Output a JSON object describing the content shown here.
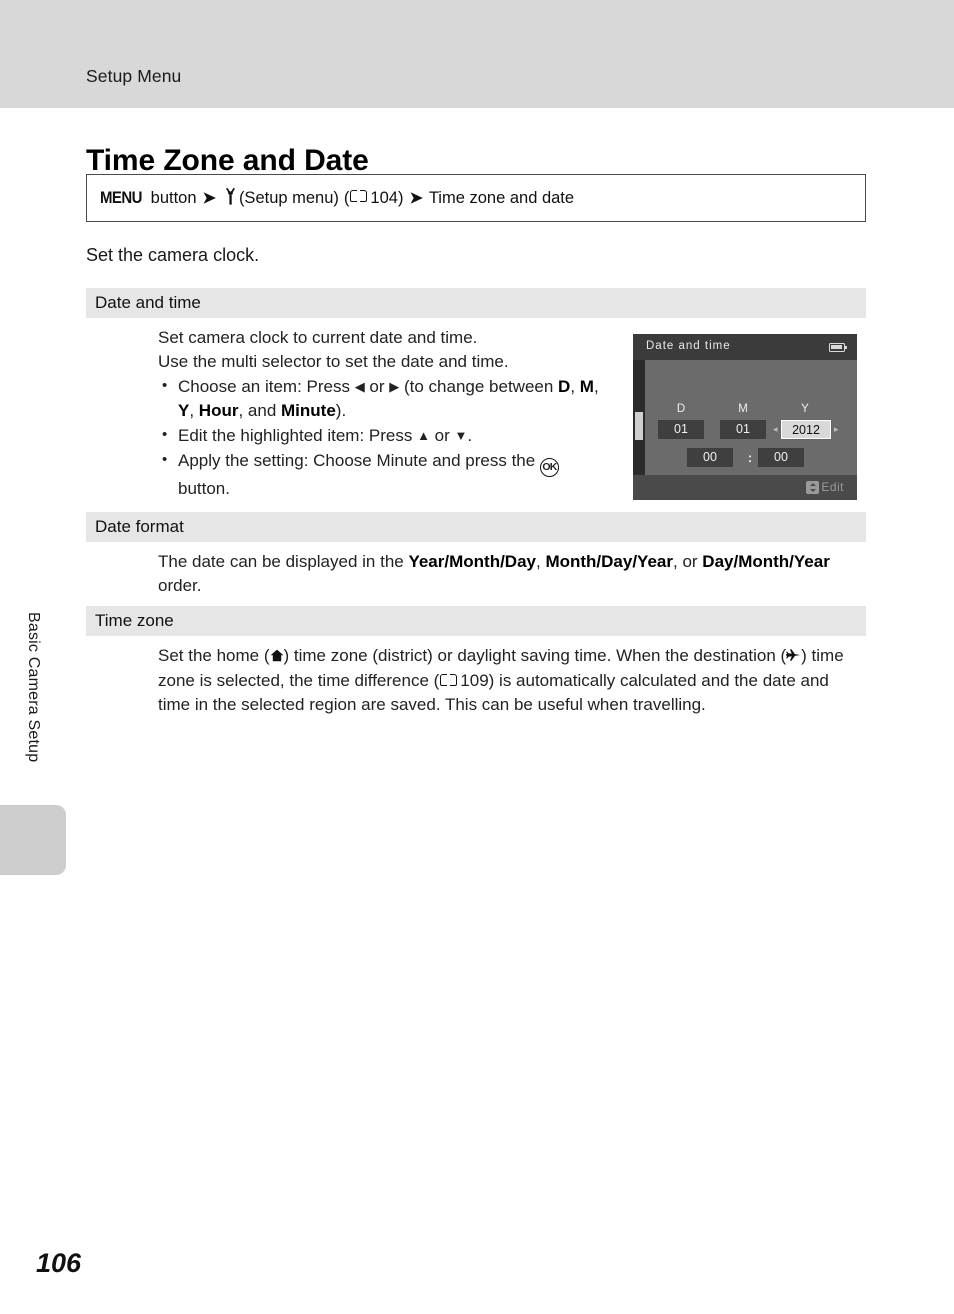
{
  "header": {
    "running_head": "Setup Menu"
  },
  "side_tab": {
    "chapter_label": "Basic Camera Setup"
  },
  "title": "Time Zone and Date",
  "breadcrumb": {
    "menu_label": "MENU",
    "button_word": "button",
    "arrow": "➔",
    "wrench_icon": "ὒ7",
    "setup_menu_text": "(Setup menu)",
    "open_paren": "(",
    "ref_page": "104",
    "close_paren": ")",
    "arrow2": "➔",
    "destination": "Time zone and date"
  },
  "intro": "Set the camera clock.",
  "sections": [
    {
      "id": "date-and-time",
      "heading": "Date and time",
      "lines": [
        "Set camera clock to current date and time.",
        "Use the multi selector to set the date and time."
      ],
      "bullets": [
        {
          "pre": "Choose an item: Press ",
          "left_arrow": "◀",
          "mid_or": " or ",
          "right_arrow": "▶",
          "post": " (to change between ",
          "bold_items": [
            "D",
            "M",
            "Y",
            "Hour",
            "Minute"
          ],
          "tail": ")."
        },
        {
          "pre": "Edit the highlighted item: Press ",
          "up_arrow": "▲",
          "mid_or": " or ",
          "down_arrow": "▼",
          "tail": "."
        },
        {
          "pre": "Apply the setting: Choose Minute and press the ",
          "ok_icon": "OK",
          "tail": " button."
        }
      ]
    },
    {
      "id": "date-format",
      "heading": "Date format",
      "body_pre": "The date can be displayed in the ",
      "formats": [
        "Year/Month/Day",
        "Month/Day/Year",
        "Day/Month/Year"
      ],
      "body_post": " order.",
      "conjunction": ", or "
    },
    {
      "id": "time-zone",
      "heading": "Time zone",
      "body_part1": "Set the home (",
      "home_icon": "⌂",
      "body_part2": ") time zone (district) or daylight saving time. When the destination (",
      "plane_icon": "✈",
      "body_part3": ") time zone is selected, the time difference (",
      "ref_page": "109",
      "body_part4": ") is automatically calculated and the date and time in the selected region are saved. This can be useful when travelling."
    }
  ],
  "camera_screen": {
    "title": "Date and time",
    "battery_icon": "battery-full",
    "labels": {
      "day": "D",
      "month": "M",
      "year": "Y"
    },
    "values": {
      "day": "01",
      "month": "01",
      "year": "2012"
    },
    "time": {
      "hour": "00",
      "separator": ":",
      "minute": "00"
    },
    "highlighted_field": "year",
    "chevron_left": "◂",
    "chevron_right": "▸",
    "footer_hint": "Edit"
  },
  "folio": "106"
}
